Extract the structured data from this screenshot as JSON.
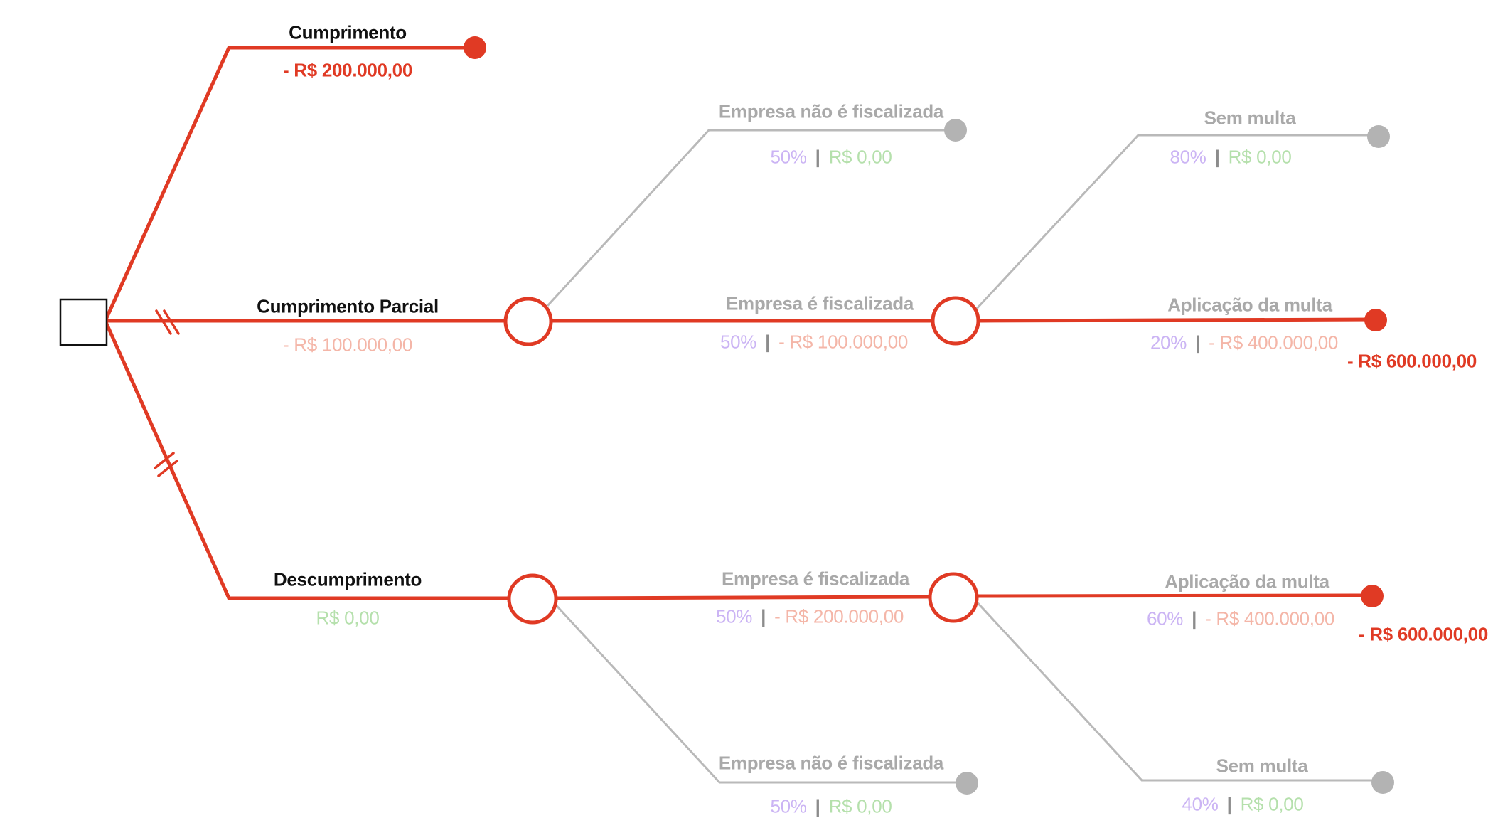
{
  "colors": {
    "active": "#e03a24",
    "inactive": "#b9b9b9",
    "end_inactive": "#b3b3b3",
    "probability": "#cbb4f4",
    "value_zero": "#b5e0ac",
    "value_negative": "#f4b6a8"
  },
  "decision": {
    "options": [
      {
        "label": "Cumprimento",
        "value": "- R$ 200.000,00"
      },
      {
        "label": "Cumprimento Parcial",
        "value": "- R$ 100.000,00"
      },
      {
        "label": "Descumprimento",
        "value": "R$ 0,00"
      }
    ]
  },
  "partial": {
    "not_inspected": {
      "label": "Empresa não é fiscalizada",
      "probability": "50%",
      "value": "R$ 0,00"
    },
    "inspected": {
      "label": "Empresa é fiscalizada",
      "probability": "50%",
      "value": "- R$ 100.000,00"
    },
    "no_fine": {
      "label": "Sem multa",
      "probability": "80%",
      "value": "R$ 0,00"
    },
    "fine": {
      "label": "Aplicação da multa",
      "probability": "20%",
      "value": "- R$ 400.000,00"
    },
    "total": "- R$ 600.000,00"
  },
  "noncompliance": {
    "inspected": {
      "label": "Empresa é fiscalizada",
      "probability": "50%",
      "value": "- R$ 200.000,00"
    },
    "not_inspected": {
      "label": "Empresa não é fiscalizada",
      "probability": "50%",
      "value": "R$ 0,00"
    },
    "fine": {
      "label": "Aplicação da multa",
      "probability": "60%",
      "value": "- R$ 400.000,00"
    },
    "no_fine": {
      "label": "Sem multa",
      "probability": "40%",
      "value": "R$ 0,00"
    },
    "total": "- R$ 600.000,00"
  }
}
